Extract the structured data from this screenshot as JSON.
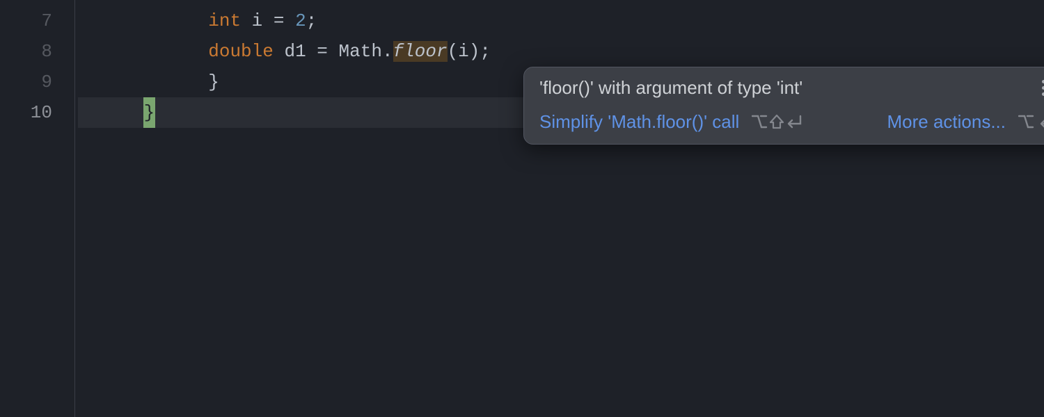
{
  "gutter": {
    "lines": [
      "7",
      "8",
      "9",
      "10"
    ],
    "activeIndex": 3
  },
  "code": {
    "line7": {
      "indent": "            ",
      "kw": "int",
      "sp1": " ",
      "id": "i",
      "sp2": " ",
      "op": "=",
      "sp3": " ",
      "num": "2",
      "semi": ";"
    },
    "line8": {
      "indent": "            ",
      "kw": "double",
      "sp1": " ",
      "id": "d1",
      "sp2": " ",
      "op": "=",
      "sp3": " ",
      "cls": "Math",
      "dot": ".",
      "meth": "floor",
      "open": "(",
      "arg": "i",
      "close": ")",
      "semi": ";"
    },
    "line9": {
      "indent": "            ",
      "brace": "}"
    },
    "line10": {
      "indent": "      ",
      "brace": "}"
    }
  },
  "popup": {
    "title": "'floor()' with argument of type 'int'",
    "simplify": "Simplify 'Math.floor()' call",
    "more": "More actions...",
    "shortcut_simplify": "⌥⇧↩",
    "shortcut_more": "⌥↩"
  }
}
